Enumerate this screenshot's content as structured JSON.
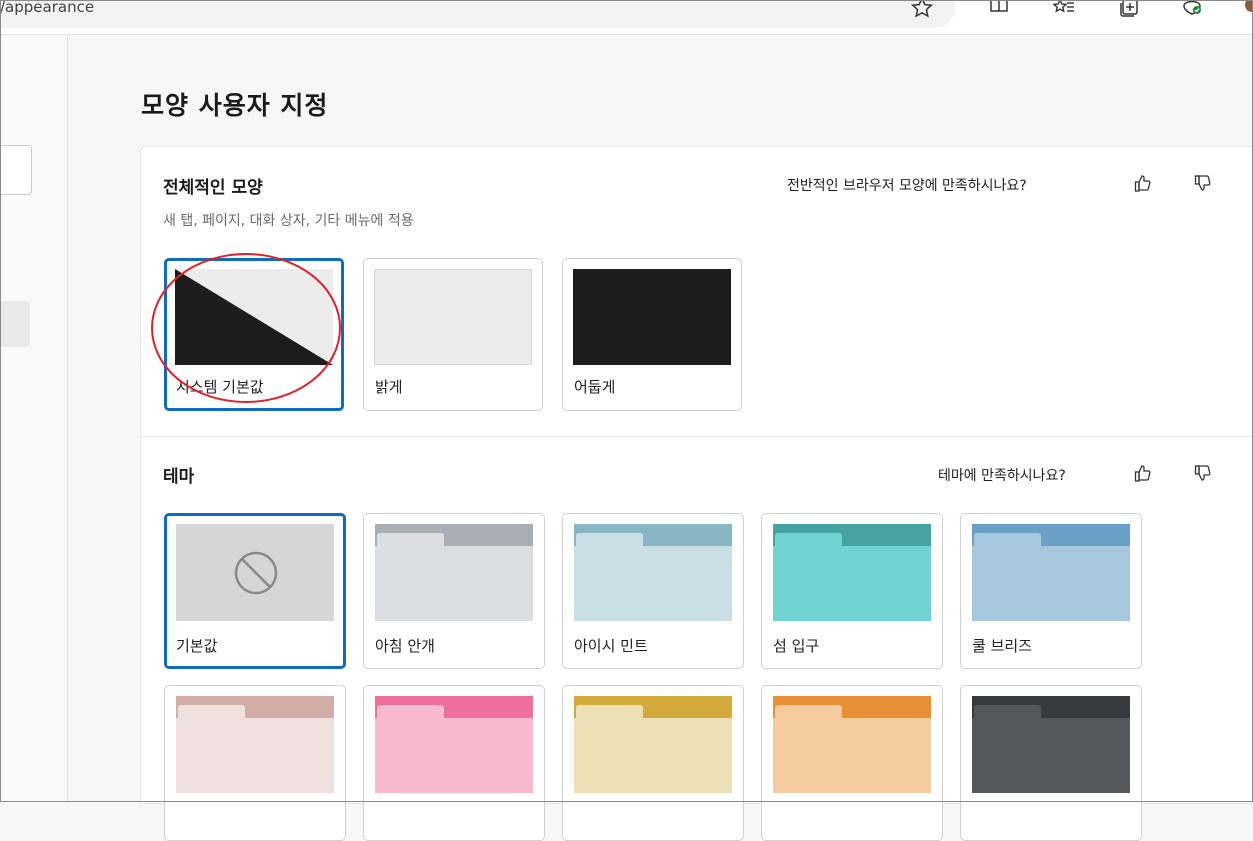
{
  "browser": {
    "url_text": "/appearance"
  },
  "page": {
    "title": "모양 사용자 지정"
  },
  "appearance": {
    "title": "전체적인 모양",
    "subtitle": "새 탭, 페이지, 대화 상자, 기타 메뉴에 적용",
    "feedback_question": "전반적인 브라우저 모양에 만족하시나요?",
    "options": [
      {
        "label": "시스템 기본값",
        "selected": true
      },
      {
        "label": "밝게",
        "selected": false
      },
      {
        "label": "어둡게",
        "selected": false
      }
    ]
  },
  "themes": {
    "title": "테마",
    "feedback_question": "테마에 만족하시나요?",
    "items": [
      {
        "label": "기본값",
        "selected": true,
        "tab_color": "#d6d6d6",
        "body_color": "#d6d6d6"
      },
      {
        "label": "아침 안개",
        "selected": false,
        "tab_color": "#a9adb6",
        "body_color": "#dcdde1"
      },
      {
        "label": "아이시 민트",
        "selected": false,
        "tab_color": "#86b7c2",
        "body_color": "#c9dfe4"
      },
      {
        "label": "섬 입구",
        "selected": false,
        "tab_color": "#46a3a2",
        "body_color": "#72d3d3"
      },
      {
        "label": "쿨 브리즈",
        "selected": false,
        "tab_color": "#6a9fc6",
        "body_color": "#a7c7dd"
      },
      {
        "label": "",
        "selected": false,
        "tab_color": "#d3aea8",
        "body_color": "#f1e1de"
      },
      {
        "label": "",
        "selected": false,
        "tab_color": "#ee6e9c",
        "body_color": "#f8b9cf"
      },
      {
        "label": "",
        "selected": false,
        "tab_color": "#d4aa3c",
        "body_color": "#ece0b7"
      },
      {
        "label": "",
        "selected": false,
        "tab_color": "#e88f35",
        "body_color": "#f3cb9f"
      },
      {
        "label": "",
        "selected": false,
        "tab_color": "#38393c",
        "body_color": "#55575b"
      }
    ]
  },
  "colors": {
    "accent": "#0f6cbd",
    "annotation": "#e0202a"
  }
}
